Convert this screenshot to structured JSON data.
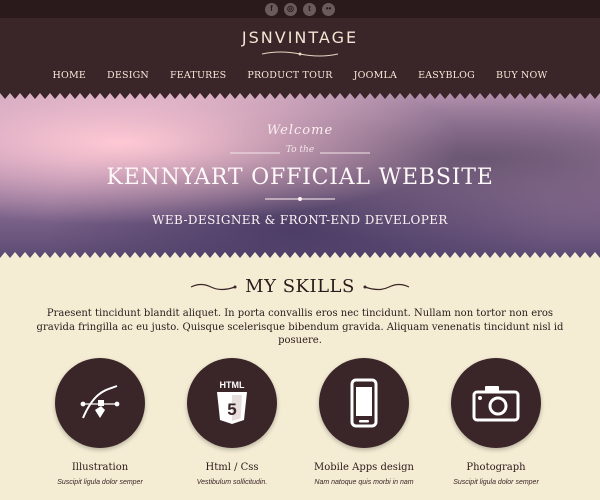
{
  "topbar": {
    "social_icons": [
      "facebook-icon",
      "dribbble-icon",
      "tumblr-icon",
      "flickr-icon"
    ]
  },
  "header": {
    "logo_text": "JSNVINTAGE",
    "nav": [
      {
        "label": "HOME"
      },
      {
        "label": "DESIGN"
      },
      {
        "label": "FEATURES"
      },
      {
        "label": "PRODUCT TOUR"
      },
      {
        "label": "JOOMLA"
      },
      {
        "label": "EASYBLOG"
      },
      {
        "label": "BUY NOW"
      }
    ]
  },
  "hero": {
    "welcome": "Welcome",
    "tothe": "To the",
    "title": "KENNYART OFFICIAL WEBSITE",
    "subtitle": "WEB-DESIGNER & FRONT-END DEVELOPER"
  },
  "skills": {
    "title": "MY SKILLS",
    "text": "Praesent tincidunt blandit aliquet. In porta convallis eros nec tincidunt. Nullam non tortor non eros gravida fringilla ac eu justo. Quisque scelerisque bibendum gravida. Aliquam venenatis tincidunt nisl id posuere.",
    "items": [
      {
        "name": "Illustration",
        "desc": "Suscipit ligula dolor semper",
        "icon": "bezier-pen-icon"
      },
      {
        "name": "Html / Css",
        "desc": "Vestibulum sollicitudin.",
        "icon": "html5-icon"
      },
      {
        "name": "Mobile Apps design",
        "desc": "Nam natoque quis morbi in nam",
        "icon": "smartphone-icon"
      },
      {
        "name": "Photograph",
        "desc": "Suscipit ligula dolor semper",
        "icon": "camera-icon"
      }
    ]
  },
  "colors": {
    "dark": "#3a2528",
    "cream": "#f4ecd3",
    "nav_text": "#f7eadb"
  }
}
